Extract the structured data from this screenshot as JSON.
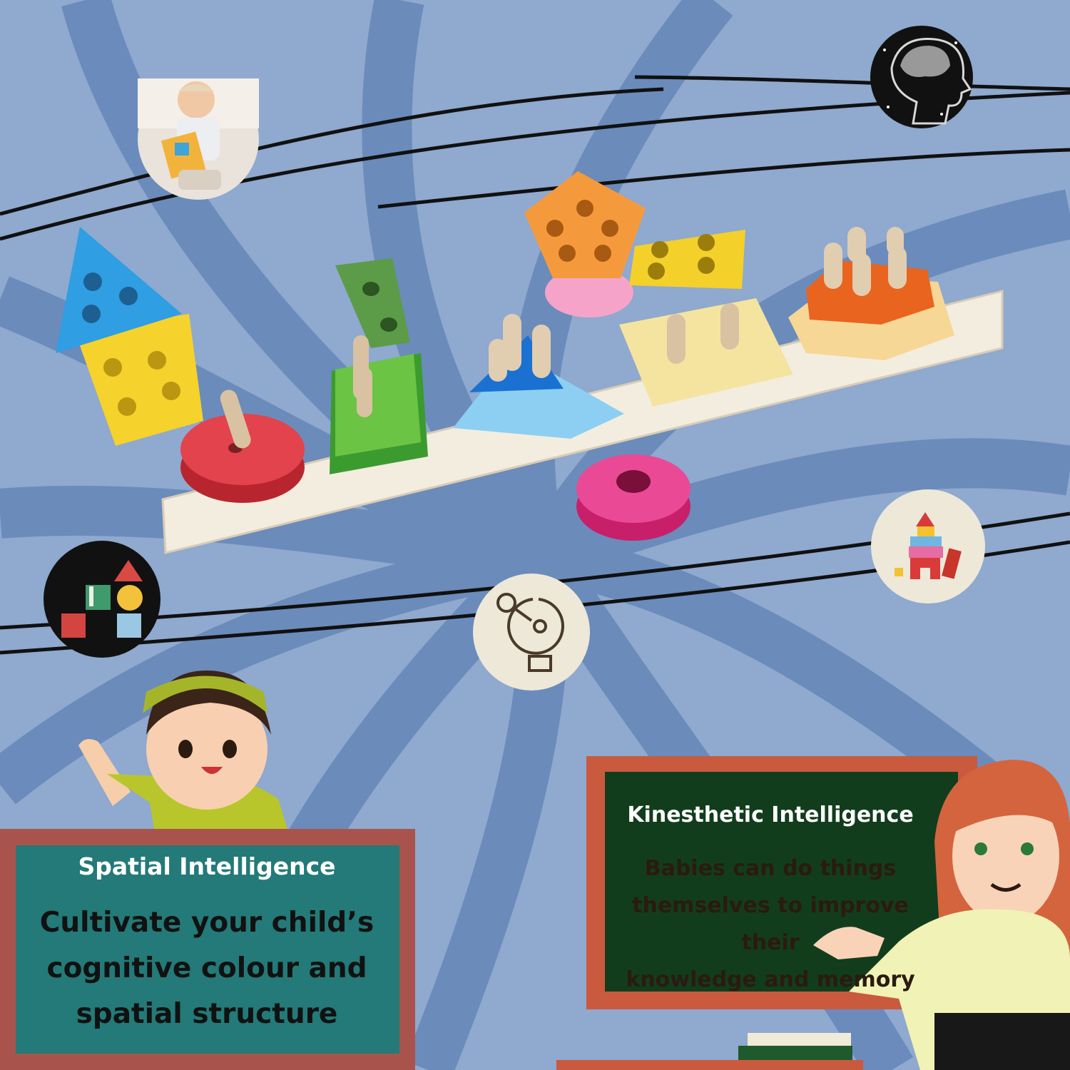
{
  "spatial": {
    "title": "Spatial Intelligence",
    "line1": "Cultivate your child’s",
    "line2": "cognitive colour and",
    "line3": "spatial structure"
  },
  "kinesthetic": {
    "title": "Kinesthetic Intelligence",
    "line1": "Babies can do things",
    "line2": "themselves to improve",
    "line3": "their",
    "line4": "knowledge and memory"
  },
  "colors": {
    "background": "#8fa9cf",
    "swirl": "#5f82b5",
    "spatial_board": "#237a78",
    "spatial_frame": "#a8544c",
    "kinesthetic_board": "#123d1c",
    "kinesthetic_frame": "#c95a3e"
  },
  "icons": [
    "baby-photo",
    "brain-head-icon",
    "shape-blocks-icon",
    "key-lightbulb-icon",
    "toy-blocks-castle-icon",
    "wooden-shape-sorter-toy",
    "boy-character",
    "teacher-character",
    "books-stack"
  ]
}
